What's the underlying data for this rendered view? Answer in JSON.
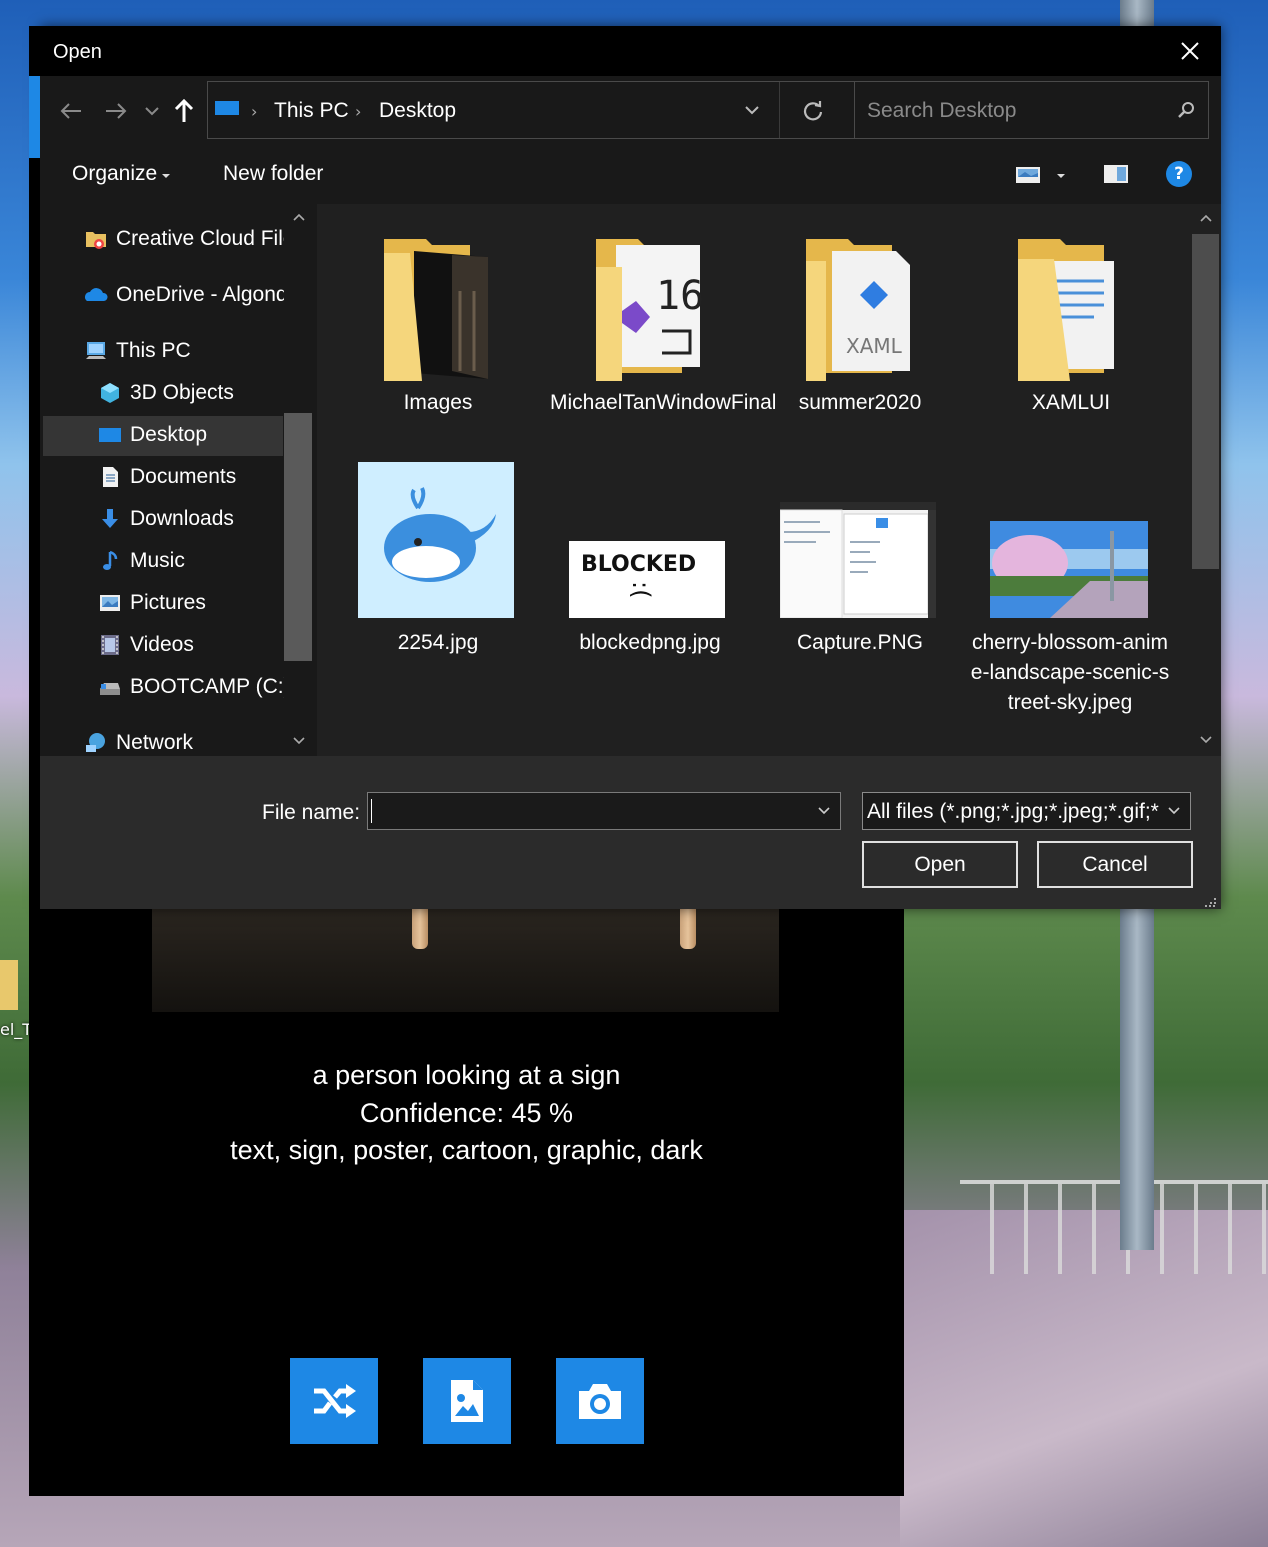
{
  "desktop": {
    "icon_label": "el_T"
  },
  "app": {
    "caption": "a person looking at a sign",
    "confidence": "Confidence: 45 %",
    "tags": "text, sign, poster, cartoon, graphic, dark",
    "buttons": [
      "shuffle-icon",
      "image-file-icon",
      "camera-icon"
    ],
    "accent_color": "#1e88e5"
  },
  "dialog": {
    "title": "Open",
    "breadcrumb": [
      "This PC",
      "Desktop"
    ],
    "search_placeholder": "Search Desktop",
    "toolbar": {
      "organize": "Organize",
      "new_folder": "New folder",
      "help": "?"
    },
    "nav_items": [
      {
        "label": "Creative Cloud Files",
        "icon": "creative-cloud-icon"
      },
      {
        "label": "OneDrive - Algonquin",
        "icon": "onedrive-cloud-icon"
      },
      {
        "label": "This PC",
        "icon": "computer-icon"
      },
      {
        "label": "3D Objects",
        "icon": "cube-icon"
      },
      {
        "label": "Desktop",
        "icon": "desktop-icon"
      },
      {
        "label": "Documents",
        "icon": "document-icon"
      },
      {
        "label": "Downloads",
        "icon": "download-arrow-icon"
      },
      {
        "label": "Music",
        "icon": "music-note-icon"
      },
      {
        "label": "Pictures",
        "icon": "pictures-icon"
      },
      {
        "label": "Videos",
        "icon": "film-icon"
      },
      {
        "label": "BOOTCAMP (C:)",
        "icon": "drive-icon"
      },
      {
        "label": "Network",
        "icon": "network-icon"
      }
    ],
    "files": [
      {
        "name": "Images",
        "type": "folder"
      },
      {
        "name": "MichaelTanWindowFinal",
        "type": "folder"
      },
      {
        "name": "summer2020",
        "type": "folder"
      },
      {
        "name": "XAMLUI",
        "type": "folder"
      },
      {
        "name": "2254.jpg",
        "type": "image"
      },
      {
        "name": "blockedpng.jpg",
        "type": "image"
      },
      {
        "name": "Capture.PNG",
        "type": "image"
      },
      {
        "name": "cherry-blossom-anime-landscape-scenic-street-sky.jpeg",
        "type": "image"
      }
    ],
    "file_name_label": "File name:",
    "file_name_value": "",
    "filter": "All files (*.png;*.jpg;*.jpeg;*.gif;*",
    "open_button": "Open",
    "cancel_button": "Cancel",
    "blocked_text": "BLOCKED",
    "blocked_face": ":("
  }
}
